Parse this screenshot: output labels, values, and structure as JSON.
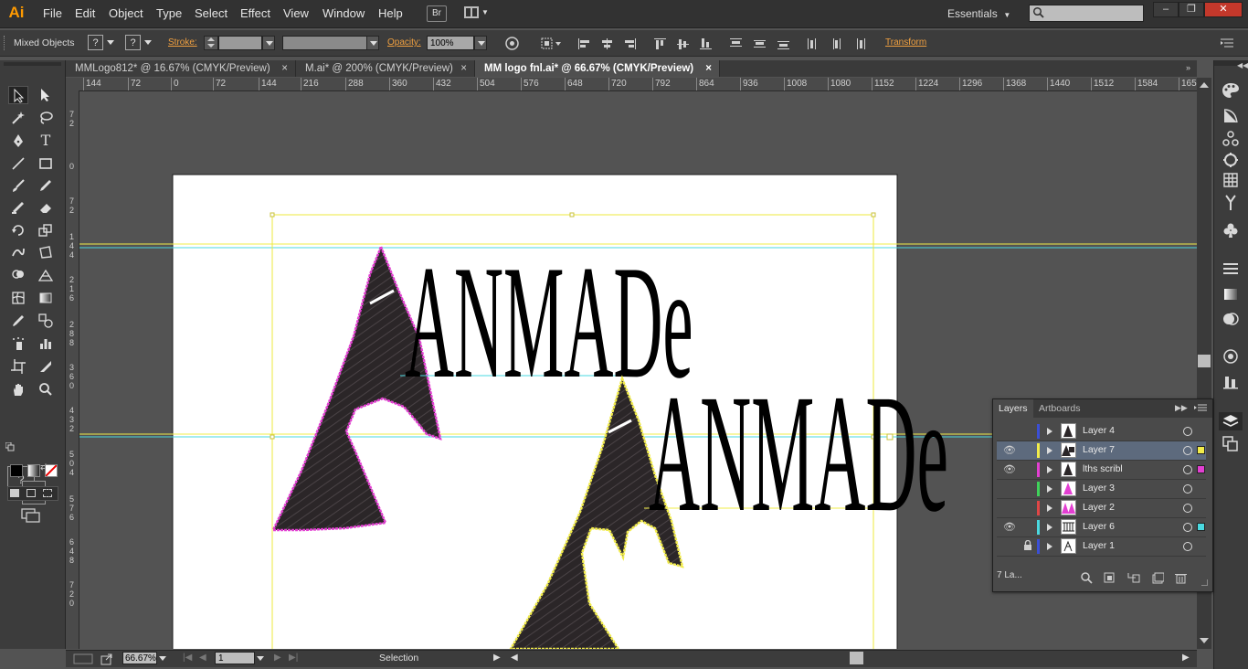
{
  "app": {
    "logo": "Ai"
  },
  "menu": [
    "File",
    "Edit",
    "Object",
    "Type",
    "Select",
    "Effect",
    "View",
    "Window",
    "Help"
  ],
  "menubar_right": {
    "bridge": "Br",
    "workspace": "Essentials",
    "window_min": "‒",
    "window_restore": "❐",
    "window_close": "✕"
  },
  "control": {
    "selection_label": "Mixed Objects",
    "stroke_label": "Stroke:",
    "opacity_label": "Opacity:",
    "opacity_value": "100%",
    "transform_label": "Transform",
    "question": "?"
  },
  "tabs": [
    {
      "label": "MMLogo812* @ 16.67% (CMYK/Preview)",
      "close": "×",
      "active": false
    },
    {
      "label": "M.ai* @ 200% (CMYK/Preview)",
      "close": "×",
      "active": false
    },
    {
      "label": "MM logo fnl.ai* @ 66.67% (CMYK/Preview)",
      "close": "×",
      "active": true
    }
  ],
  "ruler_h": [
    "144",
    "72",
    "0",
    "72",
    "144",
    "216",
    "288",
    "360",
    "432",
    "504",
    "576",
    "648",
    "720",
    "792",
    "864",
    "936",
    "1008",
    "1080",
    "1152",
    "1224",
    "1296",
    "1368",
    "1440",
    "1512",
    "1584",
    "165"
  ],
  "ruler_v": [
    {
      "digits": [
        "7",
        "2"
      ]
    },
    {
      "digits": [
        "0"
      ]
    },
    {
      "digits": [
        "7",
        "2"
      ]
    },
    {
      "digits": [
        "1",
        "4",
        "4"
      ]
    },
    {
      "digits": [
        "2",
        "1",
        "6"
      ]
    },
    {
      "digits": [
        "2",
        "8",
        "8"
      ]
    },
    {
      "digits": [
        "3",
        "6",
        "0"
      ]
    },
    {
      "digits": [
        "4",
        "3",
        "2"
      ]
    },
    {
      "digits": [
        "5",
        "0",
        "4"
      ]
    },
    {
      "digits": [
        "5",
        "7",
        "6"
      ]
    },
    {
      "digits": [
        "6",
        "4",
        "8"
      ]
    },
    {
      "digits": [
        "7",
        "2",
        "0"
      ]
    }
  ],
  "artwork": {
    "wordmark": "ANMADe"
  },
  "status": {
    "zoom": "66.67%",
    "page": "1",
    "tool": "Selection"
  },
  "tools_panel": {
    "fill_label": "?"
  },
  "layers_panel": {
    "tab_layers": "Layers",
    "tab_artboards": "Artboards",
    "count": "7 La...",
    "layers": [
      {
        "name": "Layer 4",
        "color": "#3b4fd6",
        "visible": false,
        "locked": false,
        "selected": false,
        "has_selection": false,
        "sel_color": ""
      },
      {
        "name": "Layer 7",
        "color": "#f2ec4a",
        "visible": true,
        "locked": false,
        "selected": true,
        "has_selection": true,
        "sel_color": "#f2ec4a"
      },
      {
        "name": "lths scribl",
        "color": "#e33fd2",
        "visible": true,
        "locked": false,
        "selected": false,
        "has_selection": true,
        "sel_color": "#e33fd2"
      },
      {
        "name": "Layer 3",
        "color": "#3fd25a",
        "visible": false,
        "locked": false,
        "selected": false,
        "has_selection": false,
        "sel_color": ""
      },
      {
        "name": "Layer 2",
        "color": "#e04646",
        "visible": false,
        "locked": false,
        "selected": false,
        "has_selection": false,
        "sel_color": ""
      },
      {
        "name": "Layer 6",
        "color": "#4ad9e0",
        "visible": true,
        "locked": false,
        "selected": false,
        "has_selection": true,
        "sel_color": "#4ad9e0"
      },
      {
        "name": "Layer 1",
        "color": "#3b4fd6",
        "visible": false,
        "locked": true,
        "selected": false,
        "has_selection": false,
        "sel_color": ""
      }
    ]
  },
  "colors": {
    "accent_orange": "#f0a040",
    "guide_cyan": "#4ad9e0",
    "guide_yellow": "#f2ec4a",
    "selection_magenta": "#e33fd2"
  }
}
